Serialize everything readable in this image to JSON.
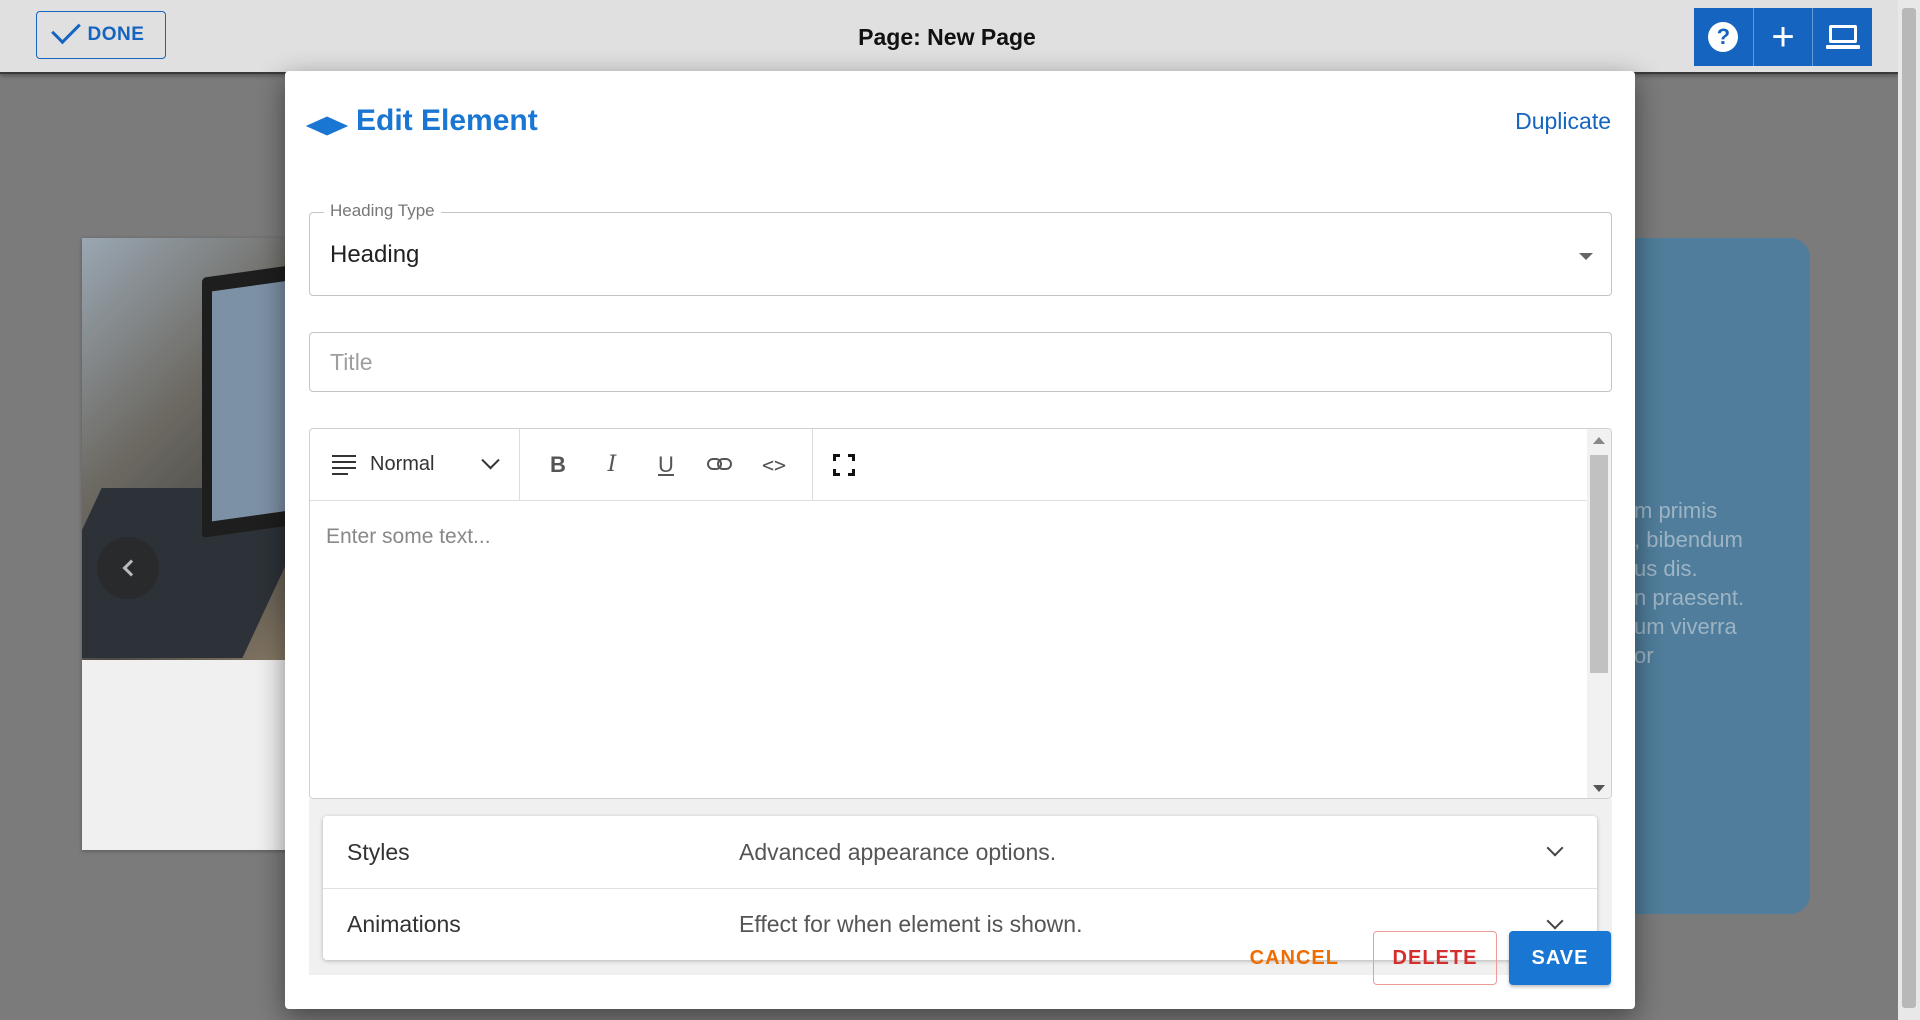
{
  "topbar": {
    "done_label": "DONE",
    "page_title": "Page: New Page",
    "tools": [
      {
        "name": "help-icon",
        "glyph": "?"
      },
      {
        "name": "plus-icon",
        "glyph": "+"
      },
      {
        "name": "laptop-icon"
      }
    ]
  },
  "background": {
    "lorem_lines": "m primis\n, bibendum\nus dis.\nn praesent.\num viverra\nor"
  },
  "modal": {
    "title": "Edit Element",
    "icon": "graduation-cap-icon",
    "duplicate_label": "Duplicate",
    "heading_type": {
      "label": "Heading Type",
      "value": "Heading"
    },
    "title_field": {
      "placeholder": "Title",
      "value": ""
    },
    "editor": {
      "format_label": "Normal",
      "placeholder": "Enter some text...",
      "toolbar": {
        "bold": "B",
        "italic": "I",
        "underline": "U",
        "code": "<>"
      }
    },
    "accordion": [
      {
        "title": "Styles",
        "description": "Advanced appearance options."
      },
      {
        "title": "Animations",
        "description": "Effect for when element is shown."
      }
    ],
    "actions": {
      "cancel": "CANCEL",
      "delete": "DELETE",
      "save": "SAVE"
    }
  },
  "colors": {
    "primary": "#1976d2",
    "cancel": "#ef6c00",
    "delete": "#d32f2f",
    "overlay": "#7b7b7b"
  }
}
